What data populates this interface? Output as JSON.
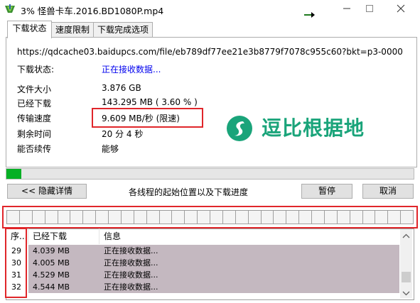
{
  "window": {
    "title": "3% 怪兽卡车.2016.BD1080P.mp4",
    "icons": [
      "app-icon",
      "minimize-icon",
      "maximize-icon",
      "close-icon"
    ]
  },
  "tabs": [
    {
      "label": "下载状态",
      "active": true
    },
    {
      "label": "速度限制",
      "active": false
    },
    {
      "label": "下载完成选项",
      "active": false
    }
  ],
  "status": {
    "url": "https://qdcache03.baidupcs.com/file/eb789df77ee21e3b8779f7078c955c60?bkt=p3-0000",
    "state_label": "下载状态:",
    "state_value": "正在接收数据...",
    "file_size_label": "文件大小",
    "file_size_value": "3.876  GB",
    "downloaded_label": "已经下载",
    "downloaded_value": "143.295  MB  ( 3.60 % )",
    "speed_label": "传输速度",
    "speed_value": "9.609  MB/秒  (限速)",
    "remaining_label": "剩余时间",
    "remaining_value": "20 分 4 秒",
    "resume_label": "能否续传",
    "resume_value": "能够"
  },
  "watermark": {
    "text": "逗比根据地",
    "color": "#1aa47a"
  },
  "progress": {
    "fraction": 0.036,
    "color": "#06b025"
  },
  "controls": {
    "hide_details": "<< 隐藏详情",
    "segments_caption": "各线程的起始位置以及下载进度",
    "pause": "暂停",
    "cancel": "取消"
  },
  "segments": {
    "count": 32
  },
  "list": {
    "headers": [
      "序...",
      "已经下载",
      "信息"
    ],
    "rows": [
      {
        "seq": "29",
        "downloaded": "4.039  MB",
        "info": "正在接收数据..."
      },
      {
        "seq": "30",
        "downloaded": "4.005  MB",
        "info": "正在接收数据..."
      },
      {
        "seq": "31",
        "downloaded": "4.529  MB",
        "info": "正在接收数据..."
      },
      {
        "seq": "32",
        "downloaded": "4.544  MB",
        "info": "正在接收数据..."
      }
    ]
  },
  "colors": {
    "highlight": "#e0262a",
    "link": "#0000ee",
    "row": "#c4b8c0"
  }
}
